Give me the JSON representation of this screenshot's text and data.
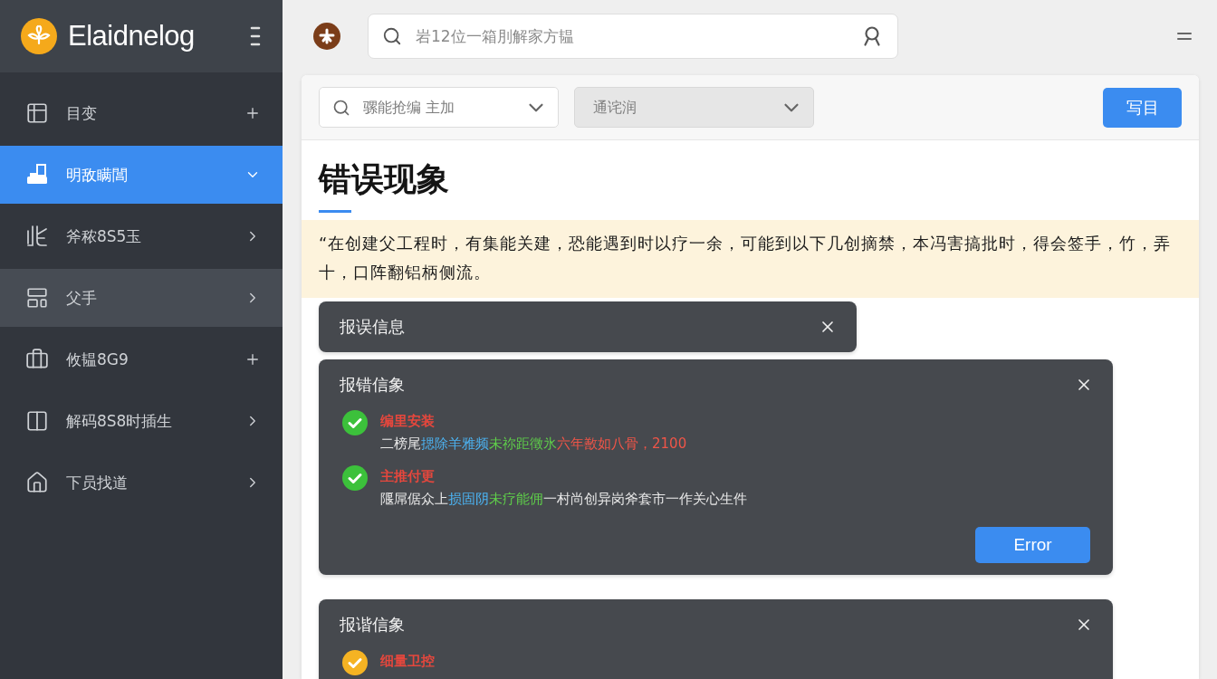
{
  "sidebar": {
    "brand": "Elaidnelog",
    "items": [
      {
        "label": "目变",
        "kind": "add",
        "expanded": false,
        "selected": false,
        "highlighted": false
      },
      {
        "label": "明敌瞒閶",
        "kind": "submenu",
        "expanded": true,
        "selected": true,
        "highlighted": false
      },
      {
        "label": "斧秾8S5玉",
        "kind": "submenu",
        "expanded": false,
        "selected": false,
        "highlighted": false
      },
      {
        "label": "父手",
        "kind": "submenu",
        "expanded": false,
        "selected": false,
        "highlighted": true
      },
      {
        "label": "攸韫8G9",
        "kind": "add",
        "expanded": false,
        "selected": false,
        "highlighted": false
      },
      {
        "label": "解码8S8时插生",
        "kind": "submenu",
        "expanded": false,
        "selected": false,
        "highlighted": false
      },
      {
        "label": "下员找道",
        "kind": "submenu",
        "expanded": false,
        "selected": false,
        "highlighted": false
      }
    ]
  },
  "topbar": {
    "search": {
      "placeholder": "岩12位一箱刖解家方韫"
    }
  },
  "filters": {
    "selects": [
      {
        "kind": "search",
        "placeholder": "骡能抢编 主加",
        "disabled": false
      },
      {
        "kind": "plain",
        "placeholder": "通诧润",
        "disabled": true
      }
    ],
    "button": "写目"
  },
  "content": {
    "title": "错误现象",
    "notice": "“在创建父工程时，有集能关建，恐能遇到时以疗一余，可能到以下几创摘禁，本冯害搞批时，得会签手，竹，弄十，口阵翻铝柄侧流。",
    "cards": [
      {
        "title": "报误信息",
        "expanded": false
      },
      {
        "title": "报错信象",
        "expanded": true,
        "items": [
          {
            "title": "编里安装",
            "color": "#3cc13b",
            "description": [
              {
                "text": "二榜尾",
                "color": "#e8e8e8"
              },
              {
                "text": "揌除羊雅频",
                "color": "#4cb2f0"
              },
              {
                "text": "未祢距徵氷",
                "color": "#5fcf4a"
              },
              {
                "text": "六年敾如八骨，2100",
                "color": "#f05548"
              }
            ]
          },
          {
            "title": "主推付更",
            "color": "#3cc13b",
            "description": [
              {
                "text": "隁屌倨众上",
                "color": "#e8e8e8"
              },
              {
                "text": "损固阴",
                "color": "#4cb2f0"
              },
              {
                "text": "未疗能佣",
                "color": "#5fcf4a"
              },
              {
                "text": "一村尚创异岗斧套市一作关心生件",
                "color": "#e8e8e8"
              }
            ]
          }
        ],
        "button": "Error"
      },
      {
        "title": "报谐信象",
        "expanded": true,
        "items": [
          {
            "title": "细量卫控",
            "color": "#f5b323"
          }
        ]
      }
    ]
  }
}
